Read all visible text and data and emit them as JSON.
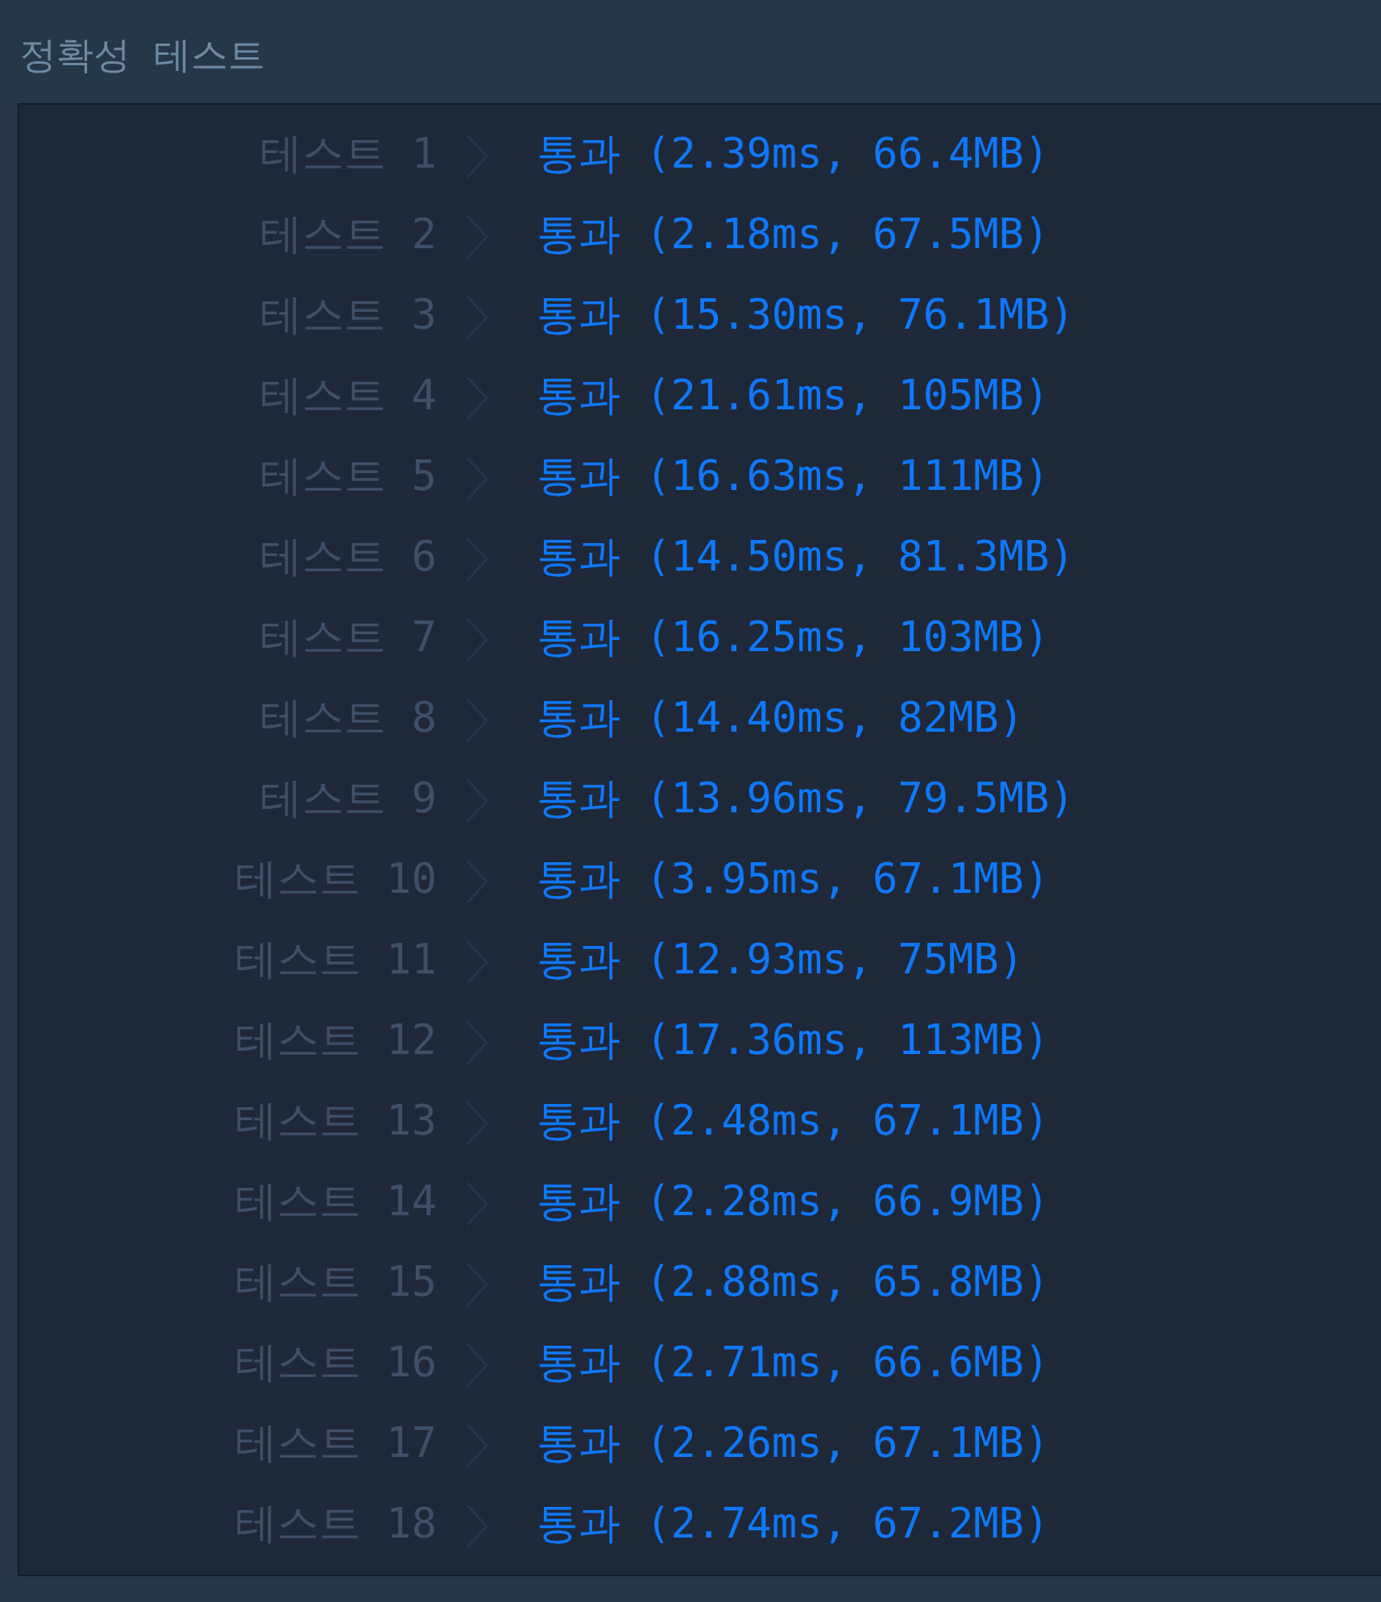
{
  "section_title": "정확성  테스트",
  "tests": [
    {
      "label": "테스트 1",
      "result": "통과 (2.39ms, 66.4MB)"
    },
    {
      "label": "테스트 2",
      "result": "통과 (2.18ms, 67.5MB)"
    },
    {
      "label": "테스트 3",
      "result": "통과 (15.30ms, 76.1MB)"
    },
    {
      "label": "테스트 4",
      "result": "통과 (21.61ms, 105MB)"
    },
    {
      "label": "테스트 5",
      "result": "통과 (16.63ms, 111MB)"
    },
    {
      "label": "테스트 6",
      "result": "통과 (14.50ms, 81.3MB)"
    },
    {
      "label": "테스트 7",
      "result": "통과 (16.25ms, 103MB)"
    },
    {
      "label": "테스트 8",
      "result": "통과 (14.40ms, 82MB)"
    },
    {
      "label": "테스트 9",
      "result": "통과 (13.96ms, 79.5MB)"
    },
    {
      "label": "테스트 10",
      "result": "통과 (3.95ms, 67.1MB)"
    },
    {
      "label": "테스트 11",
      "result": "통과 (12.93ms, 75MB)"
    },
    {
      "label": "테스트 12",
      "result": "통과 (17.36ms, 113MB)"
    },
    {
      "label": "테스트 13",
      "result": "통과 (2.48ms, 67.1MB)"
    },
    {
      "label": "테스트 14",
      "result": "통과 (2.28ms, 66.9MB)"
    },
    {
      "label": "테스트 15",
      "result": "통과 (2.88ms, 65.8MB)"
    },
    {
      "label": "테스트 16",
      "result": "통과 (2.71ms, 66.6MB)"
    },
    {
      "label": "테스트 17",
      "result": "통과 (2.26ms, 67.1MB)"
    },
    {
      "label": "테스트 18",
      "result": "통과 (2.74ms, 67.2MB)"
    }
  ]
}
